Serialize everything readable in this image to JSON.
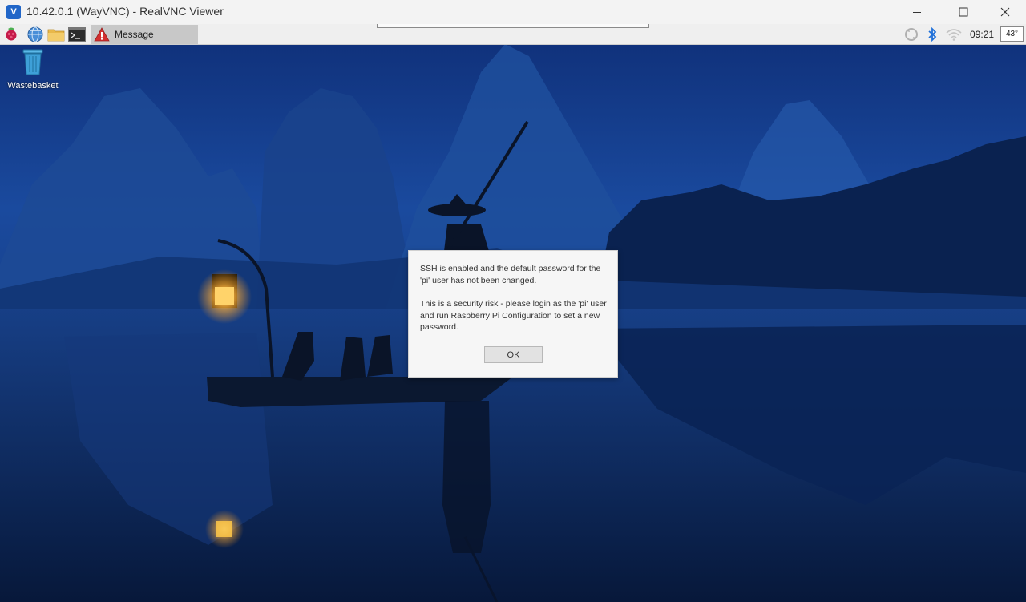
{
  "window": {
    "title": "10.42.0.1 (WayVNC) - RealVNC Viewer",
    "app_icon": "realvnc-icon",
    "controls": [
      "minimize-icon",
      "maximize-icon",
      "close-icon"
    ]
  },
  "panel": {
    "launchers": [
      "raspberry-pi-icon",
      "web-browser-icon",
      "file-manager-icon",
      "terminal-icon"
    ],
    "tasks": [
      {
        "label": "Message",
        "icon": "warning-icon"
      }
    ],
    "tray": {
      "icons": [
        "vnc-icon",
        "bluetooth-icon",
        "wifi-icon"
      ],
      "clock": "09:21",
      "cpu_temp": "43°"
    }
  },
  "desktop": {
    "icons": [
      {
        "label": "Wastebasket",
        "icon": "trash-icon"
      }
    ]
  },
  "dialog": {
    "line_1": "SSH is enabled and the default password for the 'pi' user has not been changed.",
    "line_2": "This is a security risk - please login as the 'pi' user and run Raspberry Pi Configuration to set a new password.",
    "ok_label": "OK"
  },
  "colors": {
    "accent": "#2166c8",
    "warning": "#d32f2f",
    "bluetooth": "#1e6fd9"
  }
}
